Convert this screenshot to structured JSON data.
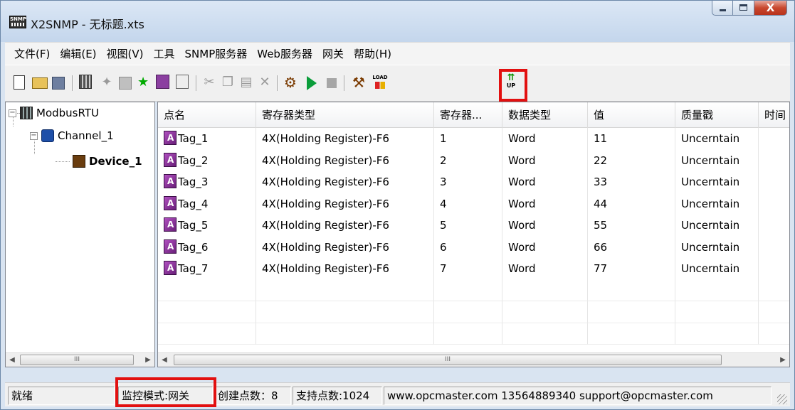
{
  "window": {
    "title": "X2SNMP - 无标题.xts",
    "app_icon_text": "SNMP",
    "close_glyph": "X"
  },
  "menu": {
    "items": [
      "文件(F)",
      "编辑(E)",
      "视图(V)",
      "工具",
      "SNMP服务器",
      "Web服务器",
      "网关",
      "帮助(H)"
    ]
  },
  "toolbar": {
    "load_label": "LOAD",
    "up_label": "UP",
    "highlight_color": "#e21010"
  },
  "tree": {
    "root": "ModbusRTU",
    "channel": "Channel_1",
    "device": "Device_1"
  },
  "grid": {
    "columns": [
      "点名",
      "寄存器类型",
      "寄存器...",
      "数据类型",
      "值",
      "质量戳",
      "时间"
    ],
    "rows": [
      {
        "name": "Tag_1",
        "reg_type": "4X(Holding Register)-F6",
        "reg": "1",
        "dtype": "Word",
        "value": "11",
        "quality": "Uncerntain"
      },
      {
        "name": "Tag_2",
        "reg_type": "4X(Holding Register)-F6",
        "reg": "2",
        "dtype": "Word",
        "value": "22",
        "quality": "Uncerntain"
      },
      {
        "name": "Tag_3",
        "reg_type": "4X(Holding Register)-F6",
        "reg": "3",
        "dtype": "Word",
        "value": "33",
        "quality": "Uncerntain"
      },
      {
        "name": "Tag_4",
        "reg_type": "4X(Holding Register)-F6",
        "reg": "4",
        "dtype": "Word",
        "value": "44",
        "quality": "Uncerntain"
      },
      {
        "name": "Tag_5",
        "reg_type": "4X(Holding Register)-F6",
        "reg": "5",
        "dtype": "Word",
        "value": "55",
        "quality": "Uncerntain"
      },
      {
        "name": "Tag_6",
        "reg_type": "4X(Holding Register)-F6",
        "reg": "6",
        "dtype": "Word",
        "value": "66",
        "quality": "Uncerntain"
      },
      {
        "name": "Tag_7",
        "reg_type": "4X(Holding Register)-F6",
        "reg": "7",
        "dtype": "Word",
        "value": "77",
        "quality": "Uncerntain"
      }
    ],
    "scroll_thumb": "III"
  },
  "status": {
    "ready": "就绪",
    "mode": "监控模式:网关",
    "created": "创建点数：8",
    "supported": "支持点数:1024",
    "contact": "www.opcmaster.com 13564889340 support@opcmaster.com"
  }
}
